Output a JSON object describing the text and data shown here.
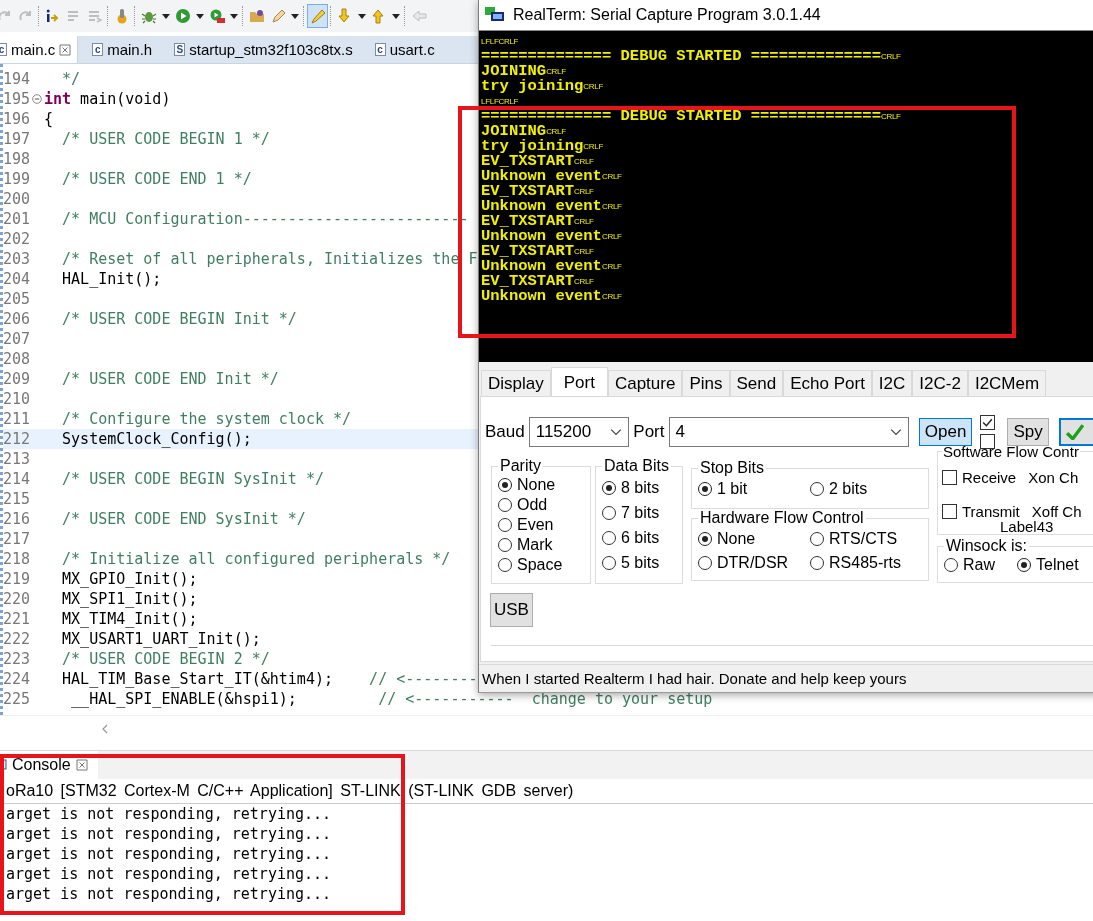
{
  "ide": {
    "toolbar": [
      {
        "kind": "step-return",
        "disabled": true,
        "pressed": false
      },
      {
        "kind": "step-over",
        "disabled": true,
        "pressed": false
      },
      {
        "kind": "separator"
      },
      {
        "kind": "instruction-step",
        "disabled": false,
        "pressed": false
      },
      {
        "kind": "lines",
        "disabled": true,
        "pressed": false
      },
      {
        "kind": "lines-arrow",
        "disabled": true,
        "pressed": false
      },
      {
        "kind": "separator"
      },
      {
        "kind": "gear",
        "disabled": false,
        "pressed": false
      },
      {
        "kind": "separator"
      },
      {
        "kind": "bug",
        "disabled": false,
        "pressed": false
      },
      {
        "kind": "dropdown"
      },
      {
        "kind": "run",
        "disabled": false,
        "pressed": false
      },
      {
        "kind": "dropdown"
      },
      {
        "kind": "external-tool",
        "disabled": false,
        "pressed": false
      },
      {
        "kind": "dropdown"
      },
      {
        "kind": "separator"
      },
      {
        "kind": "folder",
        "disabled": false,
        "pressed": false
      },
      {
        "kind": "pen",
        "disabled": false,
        "pressed": false
      },
      {
        "kind": "dropdown"
      },
      {
        "kind": "separator"
      },
      {
        "kind": "highlighter",
        "disabled": false,
        "pressed": true
      },
      {
        "kind": "separator"
      },
      {
        "kind": "arrow-down",
        "disabled": false,
        "pressed": false
      },
      {
        "kind": "dropdown"
      },
      {
        "kind": "arrow-up",
        "disabled": false,
        "pressed": false
      },
      {
        "kind": "dropdown"
      },
      {
        "kind": "separator"
      },
      {
        "kind": "arrow-left",
        "disabled": true,
        "pressed": false
      }
    ],
    "editor_tabs": [
      {
        "label": "main.c",
        "file_type": "c",
        "selected": true,
        "closable": true
      },
      {
        "label": "main.h",
        "file_type": "c",
        "selected": false,
        "closable": false
      },
      {
        "label": "startup_stm32f103c8tx.s",
        "file_type": "S",
        "selected": false,
        "closable": false
      },
      {
        "label": "usart.c",
        "file_type": "c",
        "selected": false,
        "closable": false
      }
    ],
    "code_lines": [
      {
        "number": "194",
        "collapsible": false,
        "highlighted": false,
        "segments": [
          {
            "kind": "comment",
            "text": "  */"
          }
        ]
      },
      {
        "number": "195",
        "collapsible": true,
        "highlighted": false,
        "segments": [
          {
            "kind": "keyword",
            "text": "int"
          },
          {
            "kind": "code",
            "text": " main(void)"
          }
        ]
      },
      {
        "number": "196",
        "collapsible": false,
        "highlighted": false,
        "segments": [
          {
            "kind": "code",
            "text": "{"
          }
        ]
      },
      {
        "number": "197",
        "collapsible": false,
        "highlighted": false,
        "segments": [
          {
            "kind": "comment",
            "text": "  /* USER CODE BEGIN 1 */"
          }
        ]
      },
      {
        "number": "198",
        "collapsible": false,
        "highlighted": false
      },
      {
        "number": "199",
        "collapsible": false,
        "highlighted": false,
        "segments": [
          {
            "kind": "comment",
            "text": "  /* USER CODE END 1 */"
          }
        ]
      },
      {
        "number": "200",
        "collapsible": false,
        "highlighted": false
      },
      {
        "number": "201",
        "collapsible": false,
        "highlighted": false,
        "segments": [
          {
            "kind": "comment",
            "text": "  /* MCU Configuration-------------------------"
          }
        ]
      },
      {
        "number": "202",
        "collapsible": false,
        "highlighted": false
      },
      {
        "number": "203",
        "collapsible": false,
        "highlighted": false,
        "segments": [
          {
            "kind": "comment",
            "text": "  /* Reset of all peripherals, Initializes the F"
          }
        ]
      },
      {
        "number": "204",
        "collapsible": false,
        "highlighted": false,
        "segments": [
          {
            "kind": "code",
            "text": "  HAL_Init();"
          }
        ]
      },
      {
        "number": "205",
        "collapsible": false,
        "highlighted": false
      },
      {
        "number": "206",
        "collapsible": false,
        "highlighted": false,
        "segments": [
          {
            "kind": "comment",
            "text": "  /* USER CODE BEGIN Init */"
          }
        ]
      },
      {
        "number": "207",
        "collapsible": false,
        "highlighted": false
      },
      {
        "number": "208",
        "collapsible": false,
        "highlighted": false
      },
      {
        "number": "209",
        "collapsible": false,
        "highlighted": false,
        "segments": [
          {
            "kind": "comment",
            "text": "  /* USER CODE END Init */"
          }
        ]
      },
      {
        "number": "210",
        "collapsible": false,
        "highlighted": false
      },
      {
        "number": "211",
        "collapsible": false,
        "highlighted": false,
        "segments": [
          {
            "kind": "comment",
            "text": "  /* Configure the system clock */"
          }
        ]
      },
      {
        "number": "212",
        "collapsible": false,
        "highlighted": true,
        "segments": [
          {
            "kind": "code",
            "text": "  SystemClock_Config();"
          }
        ]
      },
      {
        "number": "213",
        "collapsible": false,
        "highlighted": false
      },
      {
        "number": "214",
        "collapsible": false,
        "highlighted": false,
        "segments": [
          {
            "kind": "comment",
            "text": "  /* USER CODE BEGIN SysInit */"
          }
        ]
      },
      {
        "number": "215",
        "collapsible": false,
        "highlighted": false
      },
      {
        "number": "216",
        "collapsible": false,
        "highlighted": false,
        "segments": [
          {
            "kind": "comment",
            "text": "  /* USER CODE END SysInit */"
          }
        ]
      },
      {
        "number": "217",
        "collapsible": false,
        "highlighted": false
      },
      {
        "number": "218",
        "collapsible": false,
        "highlighted": false,
        "segments": [
          {
            "kind": "comment",
            "text": "  /* Initialize all configured peripherals */"
          }
        ]
      },
      {
        "number": "219",
        "collapsible": false,
        "highlighted": false,
        "segments": [
          {
            "kind": "code",
            "text": "  MX_GPIO_Init();"
          }
        ]
      },
      {
        "number": "220",
        "collapsible": false,
        "highlighted": false,
        "segments": [
          {
            "kind": "code",
            "text": "  MX_SPI1_Init();"
          }
        ]
      },
      {
        "number": "221",
        "collapsible": false,
        "highlighted": false,
        "segments": [
          {
            "kind": "code",
            "text": "  MX_TIM4_Init();"
          }
        ]
      },
      {
        "number": "222",
        "collapsible": false,
        "highlighted": false,
        "segments": [
          {
            "kind": "code",
            "text": "  MX_USART1_UART_Init();"
          }
        ]
      },
      {
        "number": "223",
        "collapsible": false,
        "highlighted": false,
        "segments": [
          {
            "kind": "comment",
            "text": "  /* USER CODE BEGIN 2 */"
          }
        ]
      },
      {
        "number": "224",
        "collapsible": false,
        "highlighted": false,
        "segments": [
          {
            "kind": "code",
            "text": "  HAL_TIM_Base_Start_IT(&htim4);    "
          },
          {
            "kind": "comment",
            "text": "// <--------"
          }
        ]
      },
      {
        "number": "225",
        "collapsible": false,
        "highlighted": false,
        "segments": [
          {
            "kind": "code",
            "text": "   __HAL_SPI_ENABLE(&hspi1);         "
          },
          {
            "kind": "comment",
            "text": "// <-----------  change to your setup"
          }
        ]
      }
    ],
    "console": {
      "title": "Console",
      "marked": true,
      "header": "oRa10 [STM32 Cortex-M C/C++ Application] ST-LINK (ST-LINK GDB server)",
      "lines": [
        "arget is not responding, retrying...",
        "arget is not responding, retrying...",
        "arget is not responding, retrying...",
        "arget is not responding, retrying...",
        "arget is not responding, retrying..."
      ]
    }
  },
  "realterm": {
    "title": "RealTerm: Serial Capture Program 3.0.1.44",
    "terminal": {
      "lines": [
        {
          "ctrl": "LFLFCRLF"
        },
        {
          "text": "============== DEBUG STARTED ==============",
          "ctrl": "CRLF"
        },
        {
          "text": "JOINING",
          "ctrl": "CRLF"
        },
        {
          "text": "try joining",
          "ctrl": "CRLF"
        },
        {
          "ctrl": "LFLFCRLF"
        }
      ],
      "marked_lines": [
        {
          "text": "============== DEBUG STARTED ==============",
          "ctrl": "CRLF"
        },
        {
          "text": "JOINING",
          "ctrl": "CRLF"
        },
        {
          "text": "try joining",
          "ctrl": "CRLF"
        },
        {
          "text": "EV_TXSTART",
          "ctrl": "CRLF"
        },
        {
          "text": "Unknown event",
          "ctrl": "CRLF"
        },
        {
          "text": "EV_TXSTART",
          "ctrl": "CRLF"
        },
        {
          "text": "Unknown event",
          "ctrl": "CRLF"
        },
        {
          "text": "EV_TXSTART",
          "ctrl": "CRLF"
        },
        {
          "text": "Unknown event",
          "ctrl": "CRLF"
        },
        {
          "text": "EV_TXSTART",
          "ctrl": "CRLF"
        },
        {
          "text": "Unknown event",
          "ctrl": "CRLF"
        },
        {
          "text": "EV_TXSTART",
          "ctrl": "CRLF"
        },
        {
          "text": "Unknown event",
          "ctrl": "CRLF"
        }
      ]
    },
    "tabs": [
      {
        "label": "Display",
        "selected": false
      },
      {
        "label": "Port",
        "selected": true
      },
      {
        "label": "Capture",
        "selected": false
      },
      {
        "label": "Pins",
        "selected": false
      },
      {
        "label": "Send",
        "selected": false
      },
      {
        "label": "Echo Port",
        "selected": false
      },
      {
        "label": "I2C",
        "selected": false
      },
      {
        "label": "I2C-2",
        "selected": false
      },
      {
        "label": "I2CMem",
        "selected": false
      }
    ],
    "baud": {
      "label": "Baud",
      "value": "115200"
    },
    "port": {
      "label": "Port",
      "value": "4"
    },
    "open_button": {
      "label": "Open",
      "pressed": true
    },
    "checkboxes": [
      {
        "checked": true
      },
      {
        "checked": false
      }
    ],
    "spy_button": {
      "label": "Spy",
      "pressed": false
    },
    "parity": {
      "title": "Parity",
      "options": [
        {
          "label": "None",
          "selected": true
        },
        {
          "label": "Odd",
          "selected": false
        },
        {
          "label": "Even",
          "selected": false
        },
        {
          "label": "Mark",
          "selected": false
        },
        {
          "label": "Space",
          "selected": false
        }
      ]
    },
    "data_bits": {
      "title": "Data Bits",
      "options": [
        {
          "label": "8 bits",
          "selected": true
        },
        {
          "label": "7 bits",
          "selected": false
        },
        {
          "label": "6 bits",
          "selected": false
        },
        {
          "label": "5 bits",
          "selected": false
        }
      ]
    },
    "stop_bits": {
      "title": "Stop Bits",
      "options": [
        {
          "label": "1 bit",
          "selected": true
        },
        {
          "label": "2 bits",
          "selected": false
        }
      ]
    },
    "hardware_flow": {
      "title": "Hardware Flow Control",
      "options": [
        {
          "label": "None",
          "selected": true
        },
        {
          "label": "RTS/CTS",
          "selected": false
        },
        {
          "label": "DTR/DSR",
          "selected": false
        },
        {
          "label": "RS485-rts",
          "selected": false
        }
      ]
    },
    "software_flow": {
      "title": "Software Flow Contr",
      "rows": [
        {
          "label": "Receive",
          "checked": false,
          "char_label": "Xon Ch"
        },
        {
          "label": "Transmit",
          "checked": false,
          "char_label": "Xoff Ch"
        }
      ],
      "extra_label": "Label43"
    },
    "winsock": {
      "title": "Winsock is:",
      "options": [
        {
          "label": "Raw",
          "selected": false
        },
        {
          "label": "Telnet",
          "selected": true
        }
      ]
    },
    "usb_button": "USB",
    "status": "When I started Realterm I had hair. Donate and help keep yours"
  }
}
